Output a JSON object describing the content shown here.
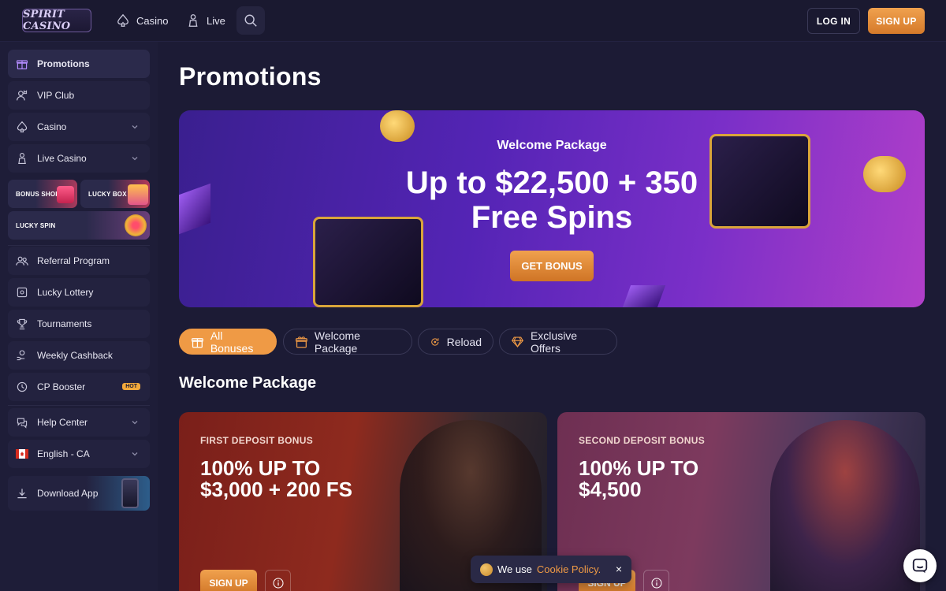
{
  "header": {
    "logo_text": "SPIRIT CASINO",
    "nav": [
      {
        "label": "Casino",
        "icon": "spade-icon"
      },
      {
        "label": "Live",
        "icon": "dealer-icon"
      }
    ],
    "search_icon": "search-icon",
    "login_label": "LOG IN",
    "signup_label": "SIGN UP"
  },
  "sidebar": {
    "items": [
      {
        "label": "Promotions",
        "icon": "gift-icon",
        "active": true
      },
      {
        "label": "VIP Club",
        "icon": "crown-user-icon"
      },
      {
        "label": "Casino",
        "icon": "spade-icon",
        "expandable": true
      },
      {
        "label": "Live Casino",
        "icon": "dealer-icon",
        "expandable": true
      }
    ],
    "promo_tiles": [
      {
        "label": "BONUS SHOP"
      },
      {
        "label": "LUCKY BOX"
      },
      {
        "label": "LUCKY SPIN"
      }
    ],
    "items2": [
      {
        "label": "Referral Program",
        "icon": "users-icon"
      },
      {
        "label": "Lucky Lottery",
        "icon": "ticket-icon"
      },
      {
        "label": "Tournaments",
        "icon": "trophy-icon"
      },
      {
        "label": "Weekly Cashback",
        "icon": "cashback-icon"
      },
      {
        "label": "CP Booster",
        "icon": "booster-icon",
        "badge": "HOT"
      }
    ],
    "help_label": "Help Center",
    "language_label": "English - CA",
    "download_label": "Download App"
  },
  "main": {
    "page_title": "Promotions",
    "hero": {
      "subtitle": "Welcome Package",
      "title_line1": "Up to $22,500 + 350",
      "title_line2": "Free Spins",
      "button_label": "GET BONUS"
    },
    "tabs": [
      {
        "label": "All Bonuses",
        "icon": "gift-icon",
        "active": true
      },
      {
        "label": "Welcome Package",
        "icon": "gift-box-icon"
      },
      {
        "label": "Reload",
        "icon": "reload-icon"
      },
      {
        "label": "Exclusive Offers",
        "icon": "diamond-icon"
      }
    ],
    "section_title": "Welcome Package",
    "cards": [
      {
        "label": "FIRST DEPOSIT BONUS",
        "title_line1": "100% UP TO",
        "title_line2": "$3,000 + 200 FS",
        "button_label": "SIGN UP"
      },
      {
        "label": "SECOND DEPOSIT BONUS",
        "title_line1": "100% UP TO",
        "title_line2": "$4,500",
        "button_label": "SIGN UP"
      }
    ]
  },
  "cookie": {
    "text": "We use",
    "link": "Cookie Policy.",
    "close": "×"
  },
  "colors": {
    "accent": "#ef9a45",
    "background": "#1c1b35",
    "sidebar": "#1e1d38"
  }
}
